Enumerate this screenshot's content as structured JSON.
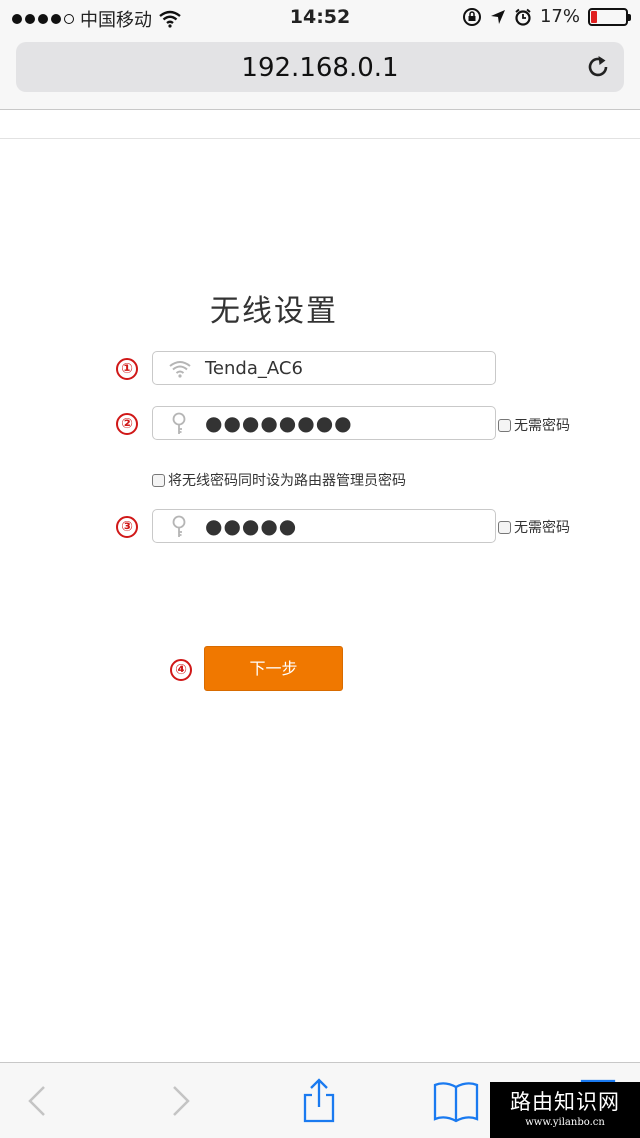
{
  "status_bar": {
    "carrier": "中国移动",
    "time": "14:52",
    "battery_text": "17%",
    "battery_level": 0.17,
    "battery_color": "#e02020",
    "icons": [
      "signal-dots-icon",
      "wifi-icon",
      "rotation-lock-icon",
      "location-arrow-icon",
      "alarm-icon",
      "battery-icon"
    ]
  },
  "browser": {
    "url": "192.168.0.1",
    "reload_icon": "reload-icon"
  },
  "form": {
    "title": "无线设置",
    "step_markers": [
      "①",
      "②",
      "③",
      "④"
    ],
    "ssid_value": "Tenda_AC6",
    "wifi_password_masked": "●●●●●●●●",
    "no_password_label": "无需密码",
    "sync_admin_label": "将无线密码同时设为路由器管理员密码",
    "admin_password_masked": "●●●●●",
    "admin_no_password_label": "无需密码",
    "next_button": "下一步",
    "accent_color": "#f07800",
    "marker_color": "#d01818"
  },
  "toolbar": {
    "icons": [
      "back-icon",
      "forward-icon",
      "share-icon",
      "bookmarks-icon",
      "tabs-icon"
    ]
  },
  "watermark": {
    "text": "路由知识网",
    "url": "www.yilanbo.cn"
  }
}
